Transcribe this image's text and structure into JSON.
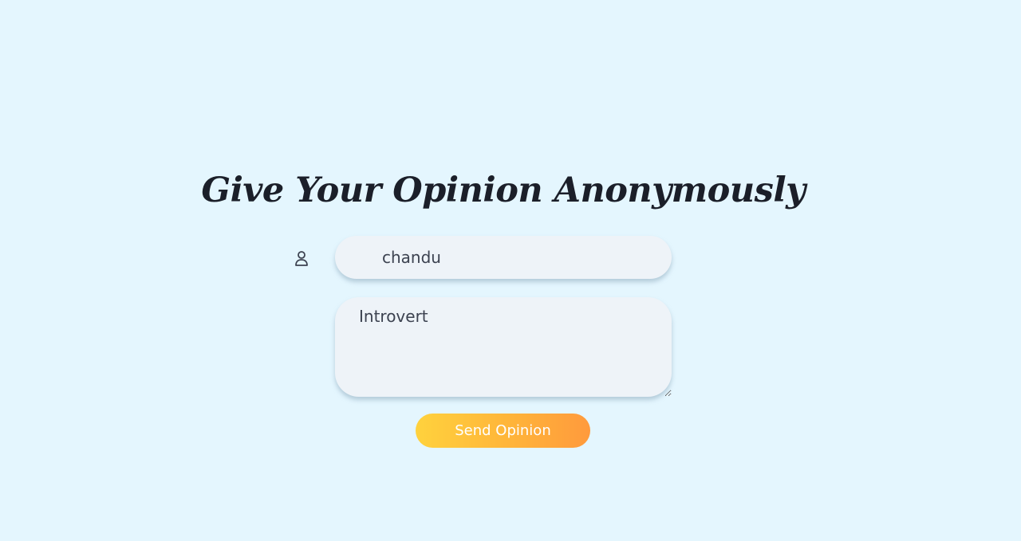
{
  "page": {
    "title": "Give Your Opinion Anonymously"
  },
  "form": {
    "user_icon": "user-icon",
    "name_value": "chandu",
    "opinion_value": "Introvert",
    "submit_label": "Send Opinion"
  },
  "colors": {
    "background": "#e4f6fe",
    "field_background": "#eef3f8",
    "title_text": "#1b1f29",
    "button_gradient_start": "#ffd23d",
    "button_gradient_end": "#ff9a3c",
    "button_text": "#ffffff"
  }
}
